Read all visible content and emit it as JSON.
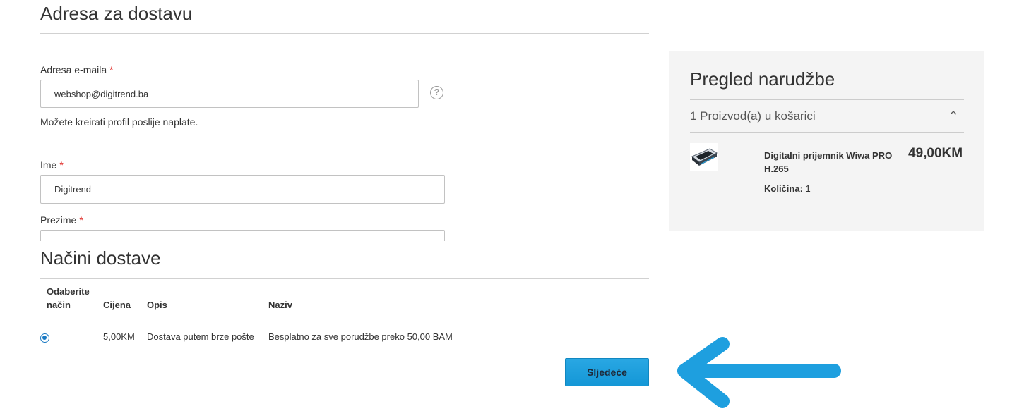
{
  "shipping_address": {
    "title": "Adresa za dostavu",
    "email": {
      "label": "Adresa e-maila",
      "required_mark": "*",
      "value": "webshop@digitrend.ba",
      "help_icon": "question-circle-icon"
    },
    "note": "Možete kreirati profil poslije naplate.",
    "first_name": {
      "label": "Ime",
      "required_mark": "*",
      "value": "Digitrend"
    },
    "last_name": {
      "label": "Prezime",
      "required_mark": "*",
      "value": ""
    }
  },
  "shipping_methods": {
    "title": "Načini dostave",
    "columns": {
      "select_line1": "Odaberite",
      "select_line2": "način",
      "price": "Cijena",
      "description": "Opis",
      "name": "Naziv"
    },
    "rows": [
      {
        "selected": true,
        "price": "5,00KM",
        "description": "Dostava putem brze pošte",
        "name": "Besplatno za sve porudžbe preko 50,00 BAM"
      }
    ],
    "next_button": "Sljedeće"
  },
  "order_summary": {
    "title": "Pregled narudžbe",
    "cart_count": "1 Proizvod(a) u košarici",
    "toggle_icon": "chevron-up-icon",
    "item": {
      "name": "Digitalni prijemnik Wiwa PRO H.265",
      "price": "49,00KM",
      "qty_label": "Količina:",
      "qty_value": "1"
    }
  },
  "annotation": {
    "icon": "arrow-left-icon",
    "color": "#1e9fdf"
  },
  "colors": {
    "accent_button": "#1e9fdf",
    "required": "#e02b27",
    "radio": "#1979c3",
    "summary_bg": "#f4f4f4"
  }
}
